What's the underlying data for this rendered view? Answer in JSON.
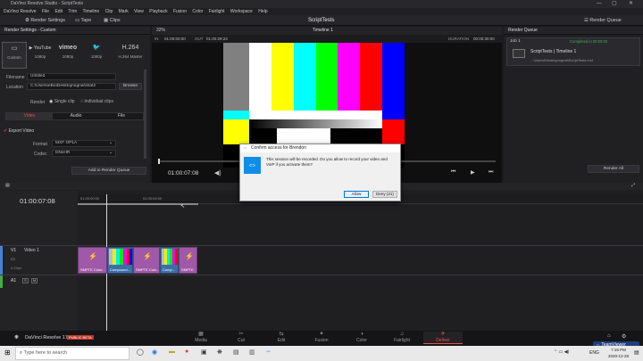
{
  "window": {
    "title": "DaVinci Resolve Studio - ScriptTests"
  },
  "menu": [
    "DaVinci Resolve",
    "File",
    "Edit",
    "Trim",
    "Timeline",
    "Clip",
    "Mark",
    "View",
    "Playback",
    "Fusion",
    "Color",
    "Fairlight",
    "Workspace",
    "Help"
  ],
  "toolbar": {
    "render_settings": "Render Settings",
    "tape": "Tape",
    "clips": "Clips",
    "project": "ScriptTests",
    "render_queue": "Render Queue"
  },
  "render_settings": {
    "header": "Render Settings - Custom",
    "presets": [
      {
        "icon": "▭",
        "label": "Custom"
      },
      {
        "icon": "▶",
        "label": "1080p"
      },
      {
        "icon": "vimeo",
        "label": "1080p"
      },
      {
        "icon": "🐦",
        "label": "1080p"
      },
      {
        "icon": "H.264",
        "label": "H.264 Master"
      }
    ],
    "filename_label": "Filename",
    "filename": "Untitled",
    "location_label": "Location",
    "location": "C:\\Users\\eBu\\Desktop\\ognal\\Stat2",
    "browse": "Browse",
    "render_label": "Render",
    "single_clip": "Single clip",
    "individual_clips": "Individual clips",
    "tabs": [
      "Video",
      "Audio",
      "File"
    ],
    "export_video": "Export Video",
    "format_label": "Format",
    "format": "MXF OP1A",
    "codec_label": "Codec",
    "codec": "DNxHR",
    "add_queue": "Add to Render Queue"
  },
  "viewer": {
    "zoom": "32%",
    "timeline": "Timeline 1",
    "in_label": "IN",
    "in_tc": "01:00:00:00",
    "out_label": "OUT",
    "out_tc": "01:00:29:23",
    "duration_label": "DURATION",
    "duration": "00:00:30:00",
    "timecode": "01:00:07:08"
  },
  "queue": {
    "header": "Render Queue",
    "job": "Job 1",
    "job_status": "Completed in 00:00:00",
    "item_title": "ScriptTests | Timeline 1",
    "item_path": "...\\Users\\Desktop\\ognal\\ScriptTests.mxf",
    "render_all": "Render All"
  },
  "timeline": {
    "timecode": "01:00:07:08",
    "ruler": [
      "01:00:00:00",
      "01:00:04:00"
    ],
    "v1_label": "V1",
    "v1_name": "Video 1",
    "v1_count": "4 Clips",
    "a1_label": "A1",
    "clips": [
      {
        "name": "SMPTE Color..."
      },
      {
        "name": "Compound..."
      },
      {
        "name": "SMPTE Colo..."
      },
      {
        "name": "Comp..."
      },
      {
        "name": "SMPTE"
      }
    ]
  },
  "pages": [
    {
      "icon": "▦",
      "label": "Media"
    },
    {
      "icon": "✂",
      "label": "Cut"
    },
    {
      "icon": "⇆",
      "label": "Edit"
    },
    {
      "icon": "✦",
      "label": "Fusion"
    },
    {
      "icon": "◑",
      "label": "Color"
    },
    {
      "icon": "♫",
      "label": "Fairlight"
    },
    {
      "icon": "✈",
      "label": "Deliver"
    }
  ],
  "brand": {
    "name": "DaVinci Resolve 17",
    "beta": "PUBLIC BETA"
  },
  "dialog": {
    "title": "Confirm access for Brendon",
    "message": "This session will be recorded. Do you allow to record your video and VoIP if you activate them?",
    "allow": "Allow",
    "deny": "Deny (21)"
  },
  "taskbar": {
    "search": "Type here to search",
    "lang": "ENG",
    "time": "7:19 PM",
    "date": "2020-12-28",
    "teamviewer": "TeamViewer"
  },
  "colors": {
    "deliver_accent": "#e8534a",
    "clip_purple": "#a058a8",
    "playhead": "#d8d8d8"
  }
}
